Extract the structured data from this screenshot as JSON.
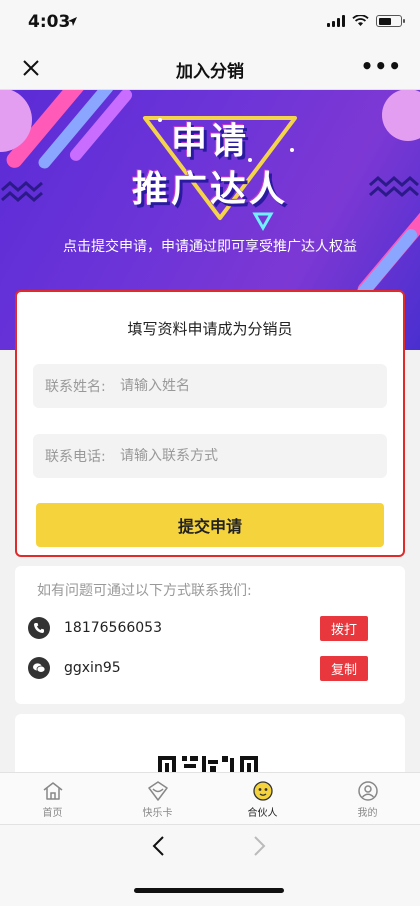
{
  "status_bar": {
    "time": "4:03",
    "location_arrow": "location-arrow-icon"
  },
  "nav": {
    "title": "加入分销",
    "close_icon": "close-icon",
    "more_label": "•••"
  },
  "banner": {
    "title_line1": "申请",
    "title_line2": "推广达人",
    "subtitle": "点击提交申请，申请通过即可享受推广达人权益"
  },
  "form": {
    "title": "填写资料申请成为分销员",
    "name_label": "联系姓名:",
    "name_placeholder": "请输入姓名",
    "name_value": "",
    "phone_label": "联系电话:",
    "phone_placeholder": "请输入联系方式",
    "phone_value": "",
    "submit_label": "提交申请",
    "highlight_color": "#e02b2b",
    "submit_color": "#f5d33d"
  },
  "contact": {
    "title": "如有问题可通过以下方式联系我们:",
    "rows": [
      {
        "icon": "phone-icon",
        "text": "18176566053",
        "button": "拨打"
      },
      {
        "icon": "wechat-icon",
        "text": "ggxin95",
        "button": "复制"
      }
    ],
    "button_color": "#e8383d"
  },
  "tabs": [
    {
      "label": "首页",
      "icon": "home-icon",
      "active": false
    },
    {
      "label": "快乐卡",
      "icon": "card-icon",
      "active": false
    },
    {
      "label": "合伙人",
      "icon": "partner-icon",
      "active": true
    },
    {
      "label": "我的",
      "icon": "profile-icon",
      "active": false
    }
  ]
}
